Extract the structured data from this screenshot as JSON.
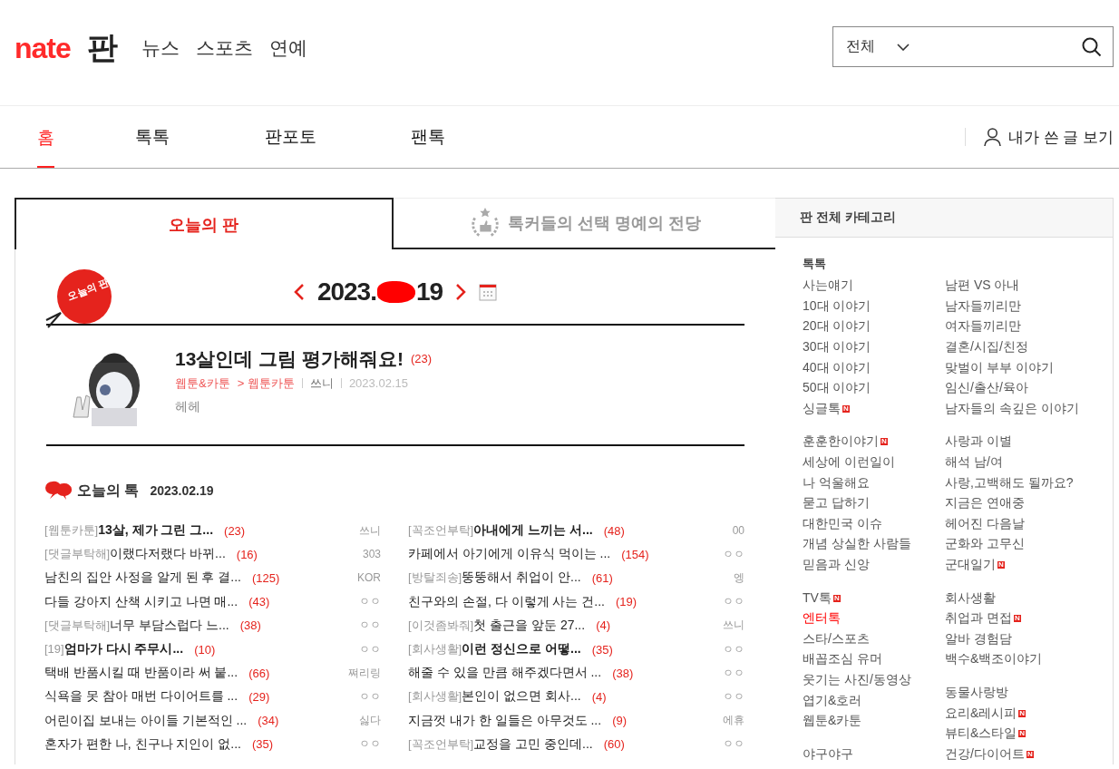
{
  "header": {
    "logo": "nate",
    "logo_sub": "판",
    "links": [
      "뉴스",
      "스포츠",
      "연예"
    ],
    "search": {
      "scope": "전체"
    }
  },
  "nav": {
    "tabs": [
      {
        "label": "홈",
        "selected": true
      },
      {
        "label": "톡톡",
        "selected": false
      },
      {
        "label": "판포토",
        "selected": false
      },
      {
        "label": "팬톡",
        "selected": false
      }
    ],
    "my_posts": "내가 쓴 글 보기"
  },
  "main_tabs": [
    {
      "label": "오늘의 판",
      "selected": true,
      "kind": "plain"
    },
    {
      "label": "톡커들의 선택 명예의 전당",
      "selected": false,
      "kind": "laurel"
    }
  ],
  "today": {
    "badge": "오늘의 판",
    "date_prefix": "2023.",
    "date_suffix": "19",
    "redacted": true,
    "featured": {
      "title": "13살인데 그림 평가해줘요!",
      "count": "(23)",
      "category": "웹툰&카툰",
      "subcategory": "> 웹툰카툰",
      "author": "쓰니",
      "date": "2023.02.15",
      "excerpt": "헤헤"
    }
  },
  "talk": {
    "title": "오늘의 톡",
    "date": "2023.02.19",
    "columns": [
      [
        {
          "tag": "[웹툰카툰]",
          "title": "13살, 제가 그린 그...",
          "bold": true,
          "count": "(23)",
          "author": "쓰니"
        },
        {
          "tag": "[댓글부탁해]",
          "title": "이랬다저랬다 바뀌...",
          "bold": false,
          "count": "(16)",
          "author": "303"
        },
        {
          "title": "남친의 집안 사정을 알게 된 후 결...",
          "bold": false,
          "count": "(125)",
          "author": "KOR"
        },
        {
          "title": "다들 강아지 산책 시키고 나면 매...",
          "bold": false,
          "count": "(43)",
          "author": "ㅇㅇ"
        },
        {
          "tag": "[댓글부탁해]",
          "title": "너무 부담스럽다 느...",
          "bold": false,
          "count": "(38)",
          "author": "ㅇㅇ"
        },
        {
          "tag": "[19]",
          "title": "엄마가 다시 주무시...",
          "bold": true,
          "count": "(10)",
          "author": "ㅇㅇ"
        },
        {
          "title": "택배 반품시킬 때 반품이라 써 붙...",
          "bold": false,
          "count": "(66)",
          "author": "쪄리링"
        },
        {
          "title": "식욕을 못 참아 매번 다이어트를 ...",
          "bold": false,
          "count": "(29)",
          "author": "ㅇㅇ"
        },
        {
          "title": "어린이집 보내는 아이들 기본적인 ...",
          "bold": false,
          "count": "(34)",
          "author": "싫다"
        },
        {
          "title": "혼자가 편한 나, 친구나 지인이 없...",
          "bold": false,
          "count": "(35)",
          "author": "ㅇㅇ"
        }
      ],
      [
        {
          "tag": "[꼭조언부탁]",
          "title": "아내에게 느끼는 서...",
          "bold": true,
          "count": "(48)",
          "author": "00"
        },
        {
          "title": "카페에서 아기에게 이유식 먹이는 ...",
          "bold": false,
          "count": "(154)",
          "author": "ㅇㅇ"
        },
        {
          "tag": "[방탈죄송]",
          "title": "뚱뚱해서 취업이 안...",
          "bold": false,
          "count": "(61)",
          "author": "엥"
        },
        {
          "title": "친구와의 손절, 다 이렇게 사는 건...",
          "bold": false,
          "count": "(19)",
          "author": "ㅇㅇ"
        },
        {
          "tag": "[이것좀봐줘]",
          "title": "첫 출근을 앞둔 27...",
          "bold": false,
          "count": "(4)",
          "author": "쓰니"
        },
        {
          "tag": "[회사생활]",
          "title": "이런 정신으로 어떻...",
          "bold": true,
          "count": "(35)",
          "author": "ㅇㅇ"
        },
        {
          "title": "해줄 수 있을 만큼 해주겠다면서 ...",
          "bold": false,
          "count": "(38)",
          "author": "ㅇㅇ"
        },
        {
          "tag": "[회사생활]",
          "title": "본인이 없으면 회사...",
          "bold": false,
          "count": "(4)",
          "author": "ㅇㅇ"
        },
        {
          "title": "지금껏 내가 한 일들은 아무것도 ...",
          "bold": false,
          "count": "(9)",
          "author": "에휴"
        },
        {
          "tag": "[꼭조언부탁]",
          "title": "교정을 고민 중인데...",
          "bold": false,
          "count": "(60)",
          "author": "ㅇㅇ"
        }
      ]
    ]
  },
  "categories": {
    "title": "판 전체 카테고리",
    "heading": "톡톡",
    "columns": [
      [
        [
          {
            "label": "사는얘기",
            "selected": false
          },
          {
            "label": "10대 이야기",
            "selected": false
          },
          {
            "label": "20대 이야기",
            "selected": false
          },
          {
            "label": "30대 이야기",
            "selected": false
          },
          {
            "label": "40대 이야기",
            "selected": false
          },
          {
            "label": "50대 이야기",
            "selected": false
          },
          {
            "label": "싱글톡",
            "selected": false,
            "badge": "N"
          }
        ],
        [
          {
            "label": "훈훈한이야기",
            "selected": false,
            "badge": "N"
          },
          {
            "label": "세상에 이런일이",
            "selected": false
          },
          {
            "label": "나 억울해요",
            "selected": false
          },
          {
            "label": "묻고 답하기",
            "selected": false
          },
          {
            "label": "대한민국 이슈",
            "selected": false
          },
          {
            "label": "개념 상실한 사람들",
            "selected": false
          },
          {
            "label": "믿음과 신앙",
            "selected": false
          }
        ],
        [
          {
            "label": "TV톡",
            "selected": false,
            "badge": "N"
          },
          {
            "label": "엔터톡",
            "selected": true
          },
          {
            "label": "스타/스포츠",
            "selected": false
          },
          {
            "label": "배꼽조심 유머",
            "selected": false
          },
          {
            "label": "웃기는 사진/동영상",
            "selected": false
          },
          {
            "label": "엽기&호러",
            "selected": false
          },
          {
            "label": "웹툰&카툰",
            "selected": false
          }
        ],
        [
          {
            "label": "야구야구",
            "selected": false
          }
        ]
      ],
      [
        [
          {
            "label": "남편 VS 아내",
            "selected": false
          },
          {
            "label": "남자들끼리만",
            "selected": false
          },
          {
            "label": "여자들끼리만",
            "selected": false
          },
          {
            "label": "결혼/시집/친정",
            "selected": false
          },
          {
            "label": "맞벌이 부부 이야기",
            "selected": false
          },
          {
            "label": "임신/출산/육아",
            "selected": false
          },
          {
            "label": "남자들의 속깊은 이야기",
            "selected": false
          }
        ],
        [
          {
            "label": "사랑과 이별",
            "selected": false
          },
          {
            "label": "해석 남/여",
            "selected": false
          },
          {
            "label": "사랑,고백해도 될까요?",
            "selected": false
          },
          {
            "label": "지금은 연애중",
            "selected": false
          },
          {
            "label": "헤어진 다음날",
            "selected": false
          },
          {
            "label": "군화와 고무신",
            "selected": false
          },
          {
            "label": "군대일기",
            "selected": false,
            "badge": "N"
          }
        ],
        [
          {
            "label": "회사생활",
            "selected": false
          },
          {
            "label": "취업과 면접",
            "selected": false,
            "badge": "N"
          },
          {
            "label": "알바 경험담",
            "selected": false
          },
          {
            "label": "백수&백조이야기",
            "selected": false
          }
        ],
        [
          {
            "label": "동물사랑방",
            "selected": false
          },
          {
            "label": "요리&레시피",
            "selected": false,
            "badge": "N"
          },
          {
            "label": "뷰티&스타일",
            "selected": false,
            "badge": "N"
          },
          {
            "label": "건강/다이어트",
            "selected": false,
            "badge": "N"
          }
        ]
      ]
    ]
  }
}
